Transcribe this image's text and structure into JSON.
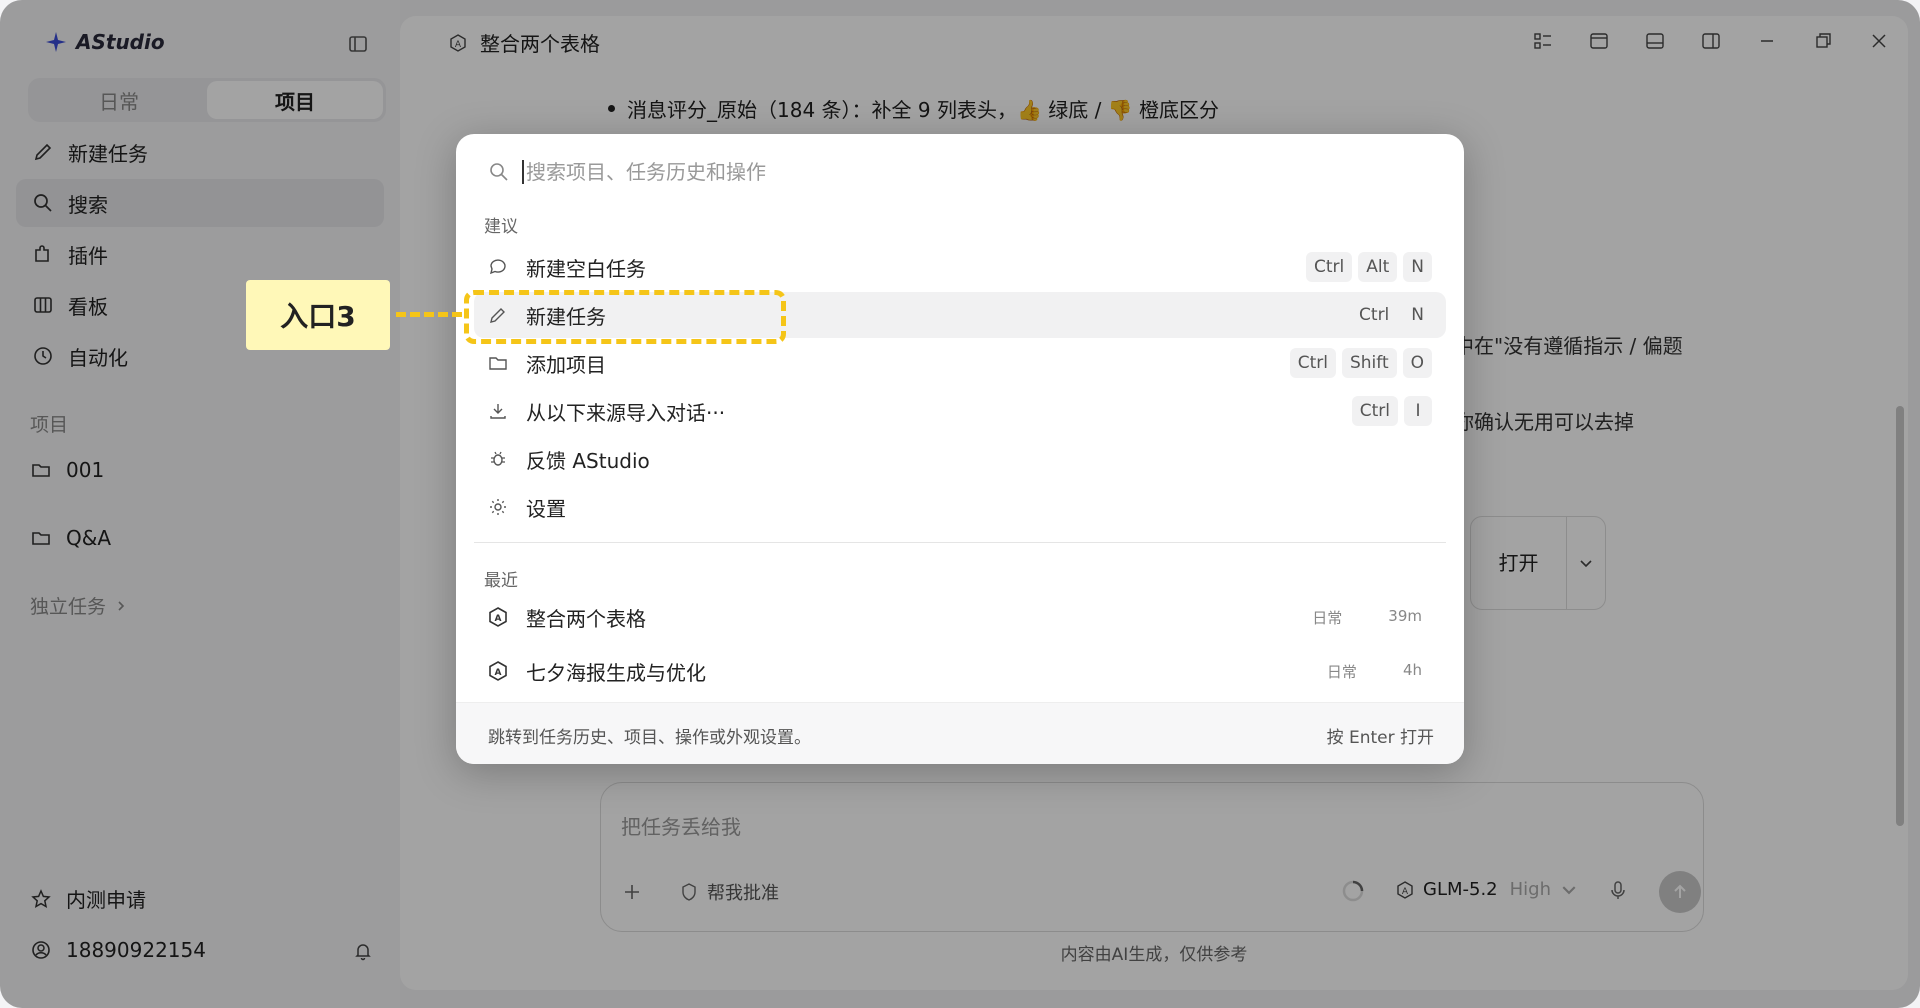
{
  "app": {
    "name": "AStudio"
  },
  "sidebar": {
    "segments": [
      {
        "label": "日常",
        "active": false
      },
      {
        "label": "项目",
        "active": true
      }
    ],
    "nav": [
      {
        "label": "新建任务",
        "icon": "pencil-icon"
      },
      {
        "label": "搜索",
        "icon": "search-icon",
        "active": true
      },
      {
        "label": "插件",
        "icon": "plugin-icon"
      },
      {
        "label": "看板",
        "icon": "kanban-icon"
      },
      {
        "label": "自动化",
        "icon": "clock-icon"
      }
    ],
    "projects_label": "项目",
    "projects": [
      {
        "label": "001"
      },
      {
        "label": "Q&A"
      }
    ],
    "standalone_label": "独立任务",
    "beta": "内测申请",
    "user": "18890922154"
  },
  "main": {
    "title": "整合两个表格",
    "bullet": "消息评分_原始（184 条）：补全 9 列表头，👍 绿底 / 👎 橙底区分",
    "fragment_1": "中在\"没有遵循指示 / 偏题",
    "fragment_2": "你确认无用可以去掉",
    "open_label": "打开",
    "composer": {
      "placeholder": "把任务丢给我",
      "approve": "帮我批准",
      "model": "GLM-5.2",
      "level": "High"
    },
    "disclaimer": "内容由AI生成，仅供参考"
  },
  "palette": {
    "search_placeholder": "搜索项目、任务历史和操作",
    "suggestions_label": "建议",
    "suggestions": [
      {
        "label": "新建空白任务",
        "icon": "chat-bubble-icon",
        "keys": [
          "Ctrl",
          "Alt",
          "N"
        ]
      },
      {
        "label": "新建任务",
        "icon": "pencil-icon",
        "keys": [
          "Ctrl",
          "N"
        ],
        "highlighted": true
      },
      {
        "label": "添加项目",
        "icon": "folder-icon",
        "keys": [
          "Ctrl",
          "Shift",
          "O"
        ]
      },
      {
        "label": "从以下来源导入对话···",
        "icon": "download-icon",
        "keys": [
          "Ctrl",
          "I"
        ]
      },
      {
        "label": "反馈 AStudio",
        "icon": "bug-icon",
        "keys": []
      },
      {
        "label": "设置",
        "icon": "gear-icon",
        "keys": []
      }
    ],
    "recent_label": "最近",
    "recent": [
      {
        "label": "整合两个表格",
        "category": "日常",
        "time": "39m"
      },
      {
        "label": "七夕海报生成与优化",
        "category": "日常",
        "time": "4h"
      }
    ],
    "footer_hint": "跳转到任务历史、项目、操作或外观设置。",
    "footer_action": "按 Enter 打开"
  },
  "annotation": {
    "label": "入口3",
    "color": "#f5c518"
  }
}
